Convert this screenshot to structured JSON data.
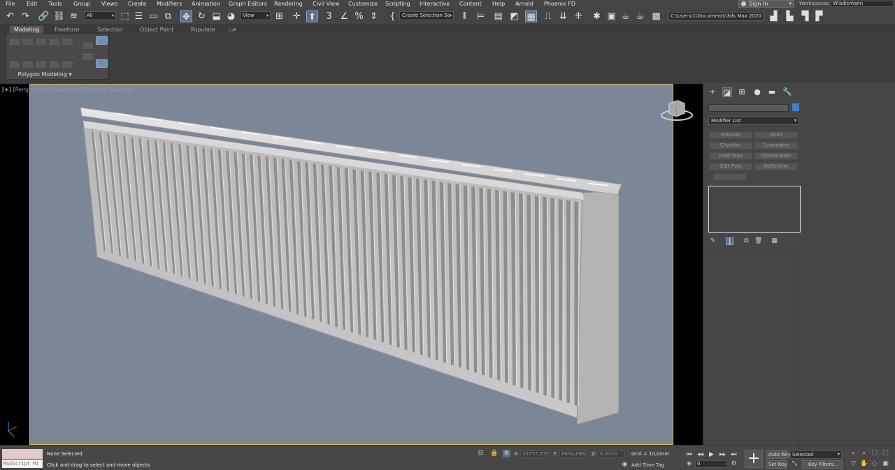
{
  "menu": [
    "File",
    "Edit",
    "Tools",
    "Group",
    "Views",
    "Create",
    "Modifiers",
    "Animation",
    "Graph Editors",
    "Rendering",
    "Civil View",
    "Customize",
    "Scripting",
    "Interactive",
    "Content",
    "Help",
    "Arnold",
    "Phoenix FD"
  ],
  "account": {
    "sign_in": "Sign In",
    "workspaces_label": "Workspaces:",
    "workspace_value": "Wladismann"
  },
  "toolbar": {
    "selection_filter": "All",
    "ref_coord": "View",
    "named_selection_placeholder": "Create Selection Se",
    "project_path": "C:\\Users\\1\\Documents\\3ds Max 2020"
  },
  "ribbon": {
    "tabs": [
      "Modeling",
      "Freeform",
      "Selection",
      "Object Paint",
      "Populate"
    ],
    "panel_label": "Polygon Modeling ▾"
  },
  "viewport": {
    "plus": "[+]",
    "view": "[Perspective]",
    "mode": "[Standard]",
    "shading": "[Default Shading]",
    "background": "#7b8797",
    "border": "#d3c34a"
  },
  "command_panel": {
    "modifier_list": "Modifier List",
    "modifiers": [
      "Extrude",
      "Shell",
      "Chamfer",
      "Symmetry",
      "UVW Map",
      "OpenSubdiv",
      "Edit Poly",
      "ReDeform"
    ],
    "object_color": "#3d7fd0"
  },
  "status": {
    "selection": "None Selected",
    "prompt": "Click and drag to select and move objects",
    "maxscript": "MAXScript Mi",
    "x_label": "X:",
    "x_value": "25777,279",
    "y_label": "Y:",
    "y_value": "6654,686m",
    "z_label": "Z:",
    "z_value": "0,0mm",
    "grid": "Grid = 10,0mm",
    "add_time_tag": "Add Time Tag",
    "frame": "0",
    "auto_key": "Auto Key",
    "set_key": "Set Key",
    "key_mode": "Selected",
    "key_filters": "Key Filters..."
  }
}
